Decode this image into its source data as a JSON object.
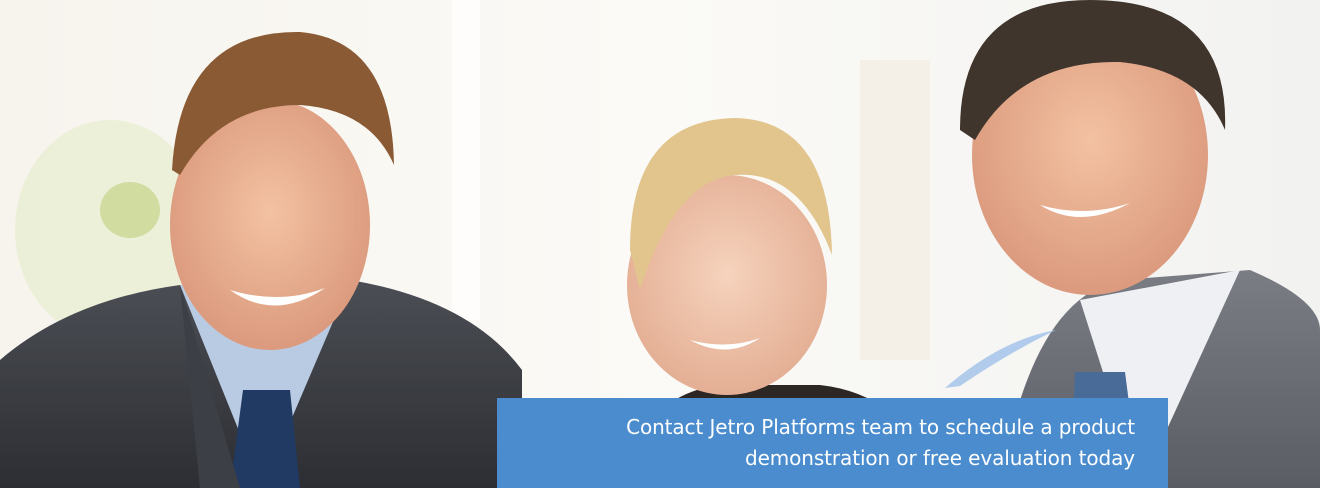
{
  "banner": {
    "cta": {
      "line1": "Contact Jetro Platforms team to schedule a product",
      "line2": "demonstration or free evaluation today",
      "background_color": "#4a8ccd",
      "text_color": "#ffffff"
    },
    "photo": {
      "subject": "three smiling business people"
    }
  }
}
